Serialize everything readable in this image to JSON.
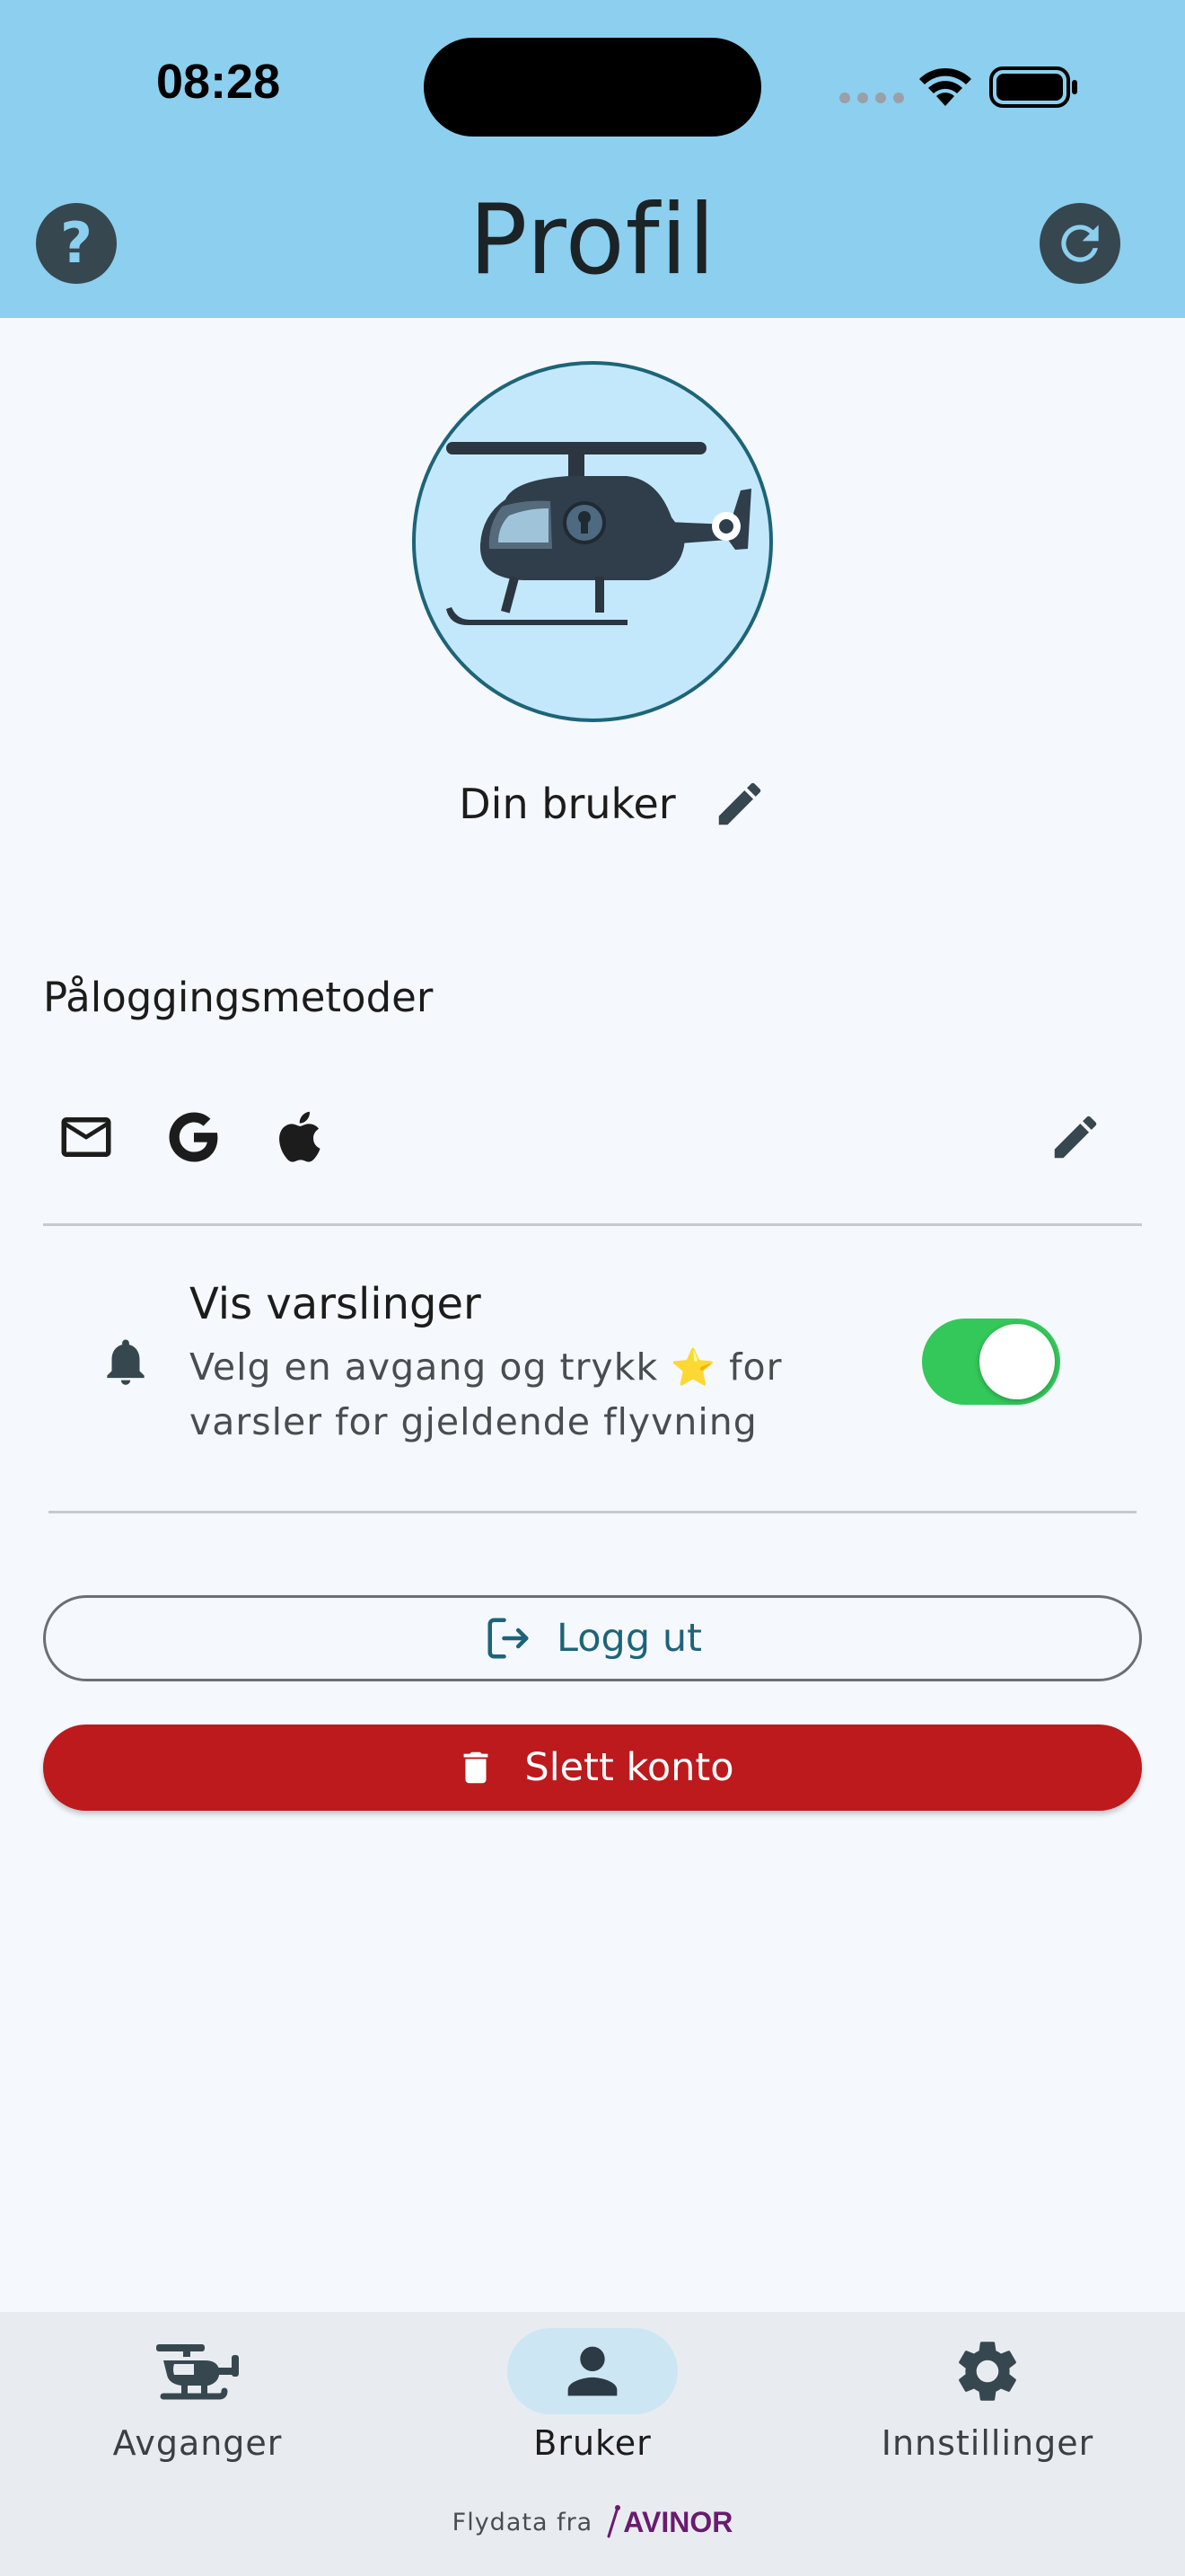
{
  "status_bar": {
    "time": "08:28"
  },
  "header": {
    "title": "Profil",
    "help_icon": "question-mark-icon",
    "refresh_icon": "refresh-icon",
    "help_glyph": "?"
  },
  "profile": {
    "avatar_icon": "helicopter-icon",
    "user_name": "Din bruker",
    "edit_icon": "pencil-icon"
  },
  "login_methods": {
    "title": "Påloggingsmetoder",
    "methods": [
      "email-icon",
      "google-icon",
      "apple-icon"
    ],
    "edit_icon": "pencil-icon"
  },
  "notifications": {
    "title": "Vis varslinger",
    "desc_prefix": "Velg en avgang og trykk",
    "desc_star": "⭐",
    "desc_suffix": "for varsler for gjeldende flyvning",
    "enabled": true
  },
  "actions": {
    "logout_label": "Logg ut",
    "delete_label": "Slett konto"
  },
  "bottom_nav": {
    "items": [
      {
        "label": "Avganger",
        "icon": "helicopter-icon",
        "active": false
      },
      {
        "label": "Bruker",
        "icon": "person-icon",
        "active": true
      },
      {
        "label": "Innstillinger",
        "icon": "gear-icon",
        "active": false
      }
    ],
    "credit_text": "Flydata fra",
    "credit_brand": "AVINOR"
  },
  "colors": {
    "header_bg": "#8ccfee",
    "accent": "#1d6478",
    "danger": "#bc1a1d",
    "toggle_on": "#34c759"
  }
}
